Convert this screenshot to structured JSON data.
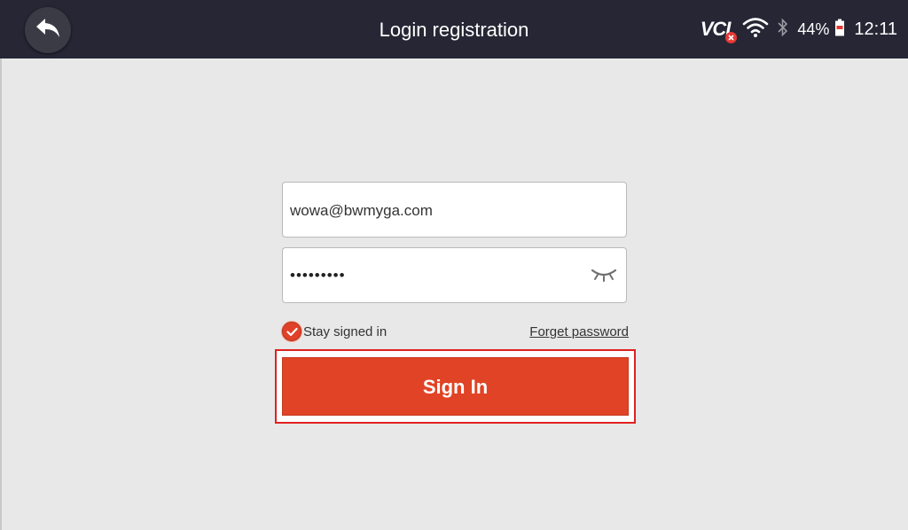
{
  "header": {
    "title": "Login registration",
    "back_icon": "back-arrow-icon"
  },
  "status_bar": {
    "vci_label": "VCI",
    "wifi_icon": "wifi-icon",
    "bluetooth_icon": "bluetooth-icon",
    "battery_percent": "44%",
    "battery_icon": "battery-icon",
    "time": "12:11"
  },
  "form": {
    "email_value": "wowa@bwmyga.com",
    "password_masked": "•••••••••",
    "toggle_visibility_icon": "eye-closed-icon",
    "stay_signed_in_label": "Stay signed in",
    "stay_signed_in_checked": true,
    "forget_password_label": "Forget password",
    "sign_in_label": "Sign In"
  },
  "colors": {
    "topbar": "#262635",
    "background": "#e8e8e8",
    "accent": "#e04325",
    "highlight_frame": "#e02020"
  }
}
